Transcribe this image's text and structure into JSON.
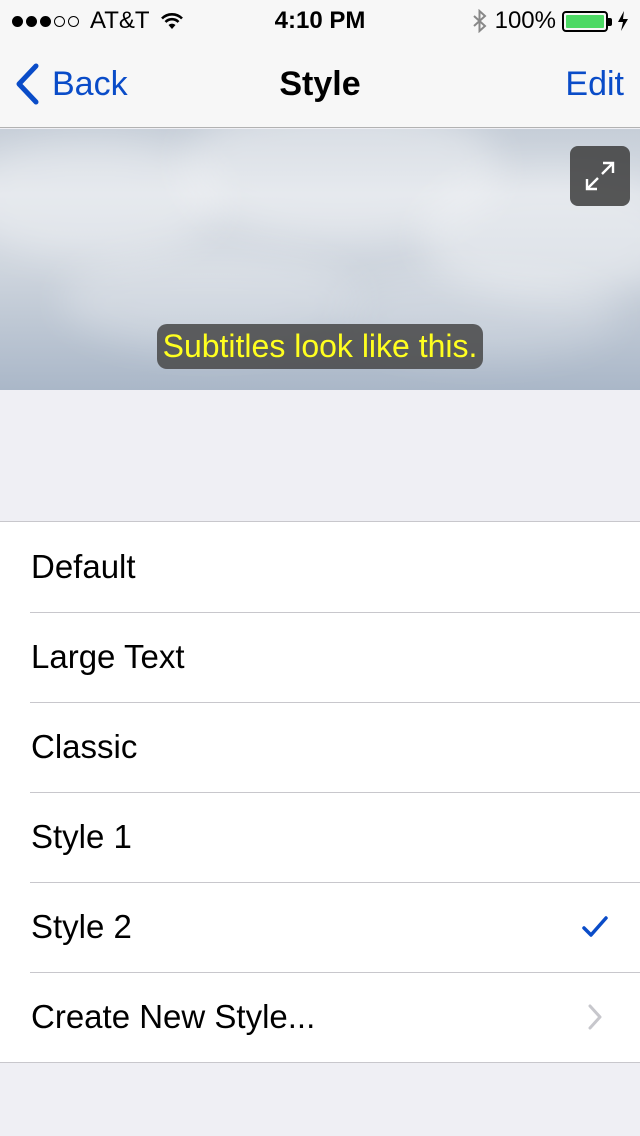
{
  "status_bar": {
    "carrier": "AT&T",
    "time": "4:10 PM",
    "battery": "100%",
    "signal_filled": 3,
    "signal_total": 5
  },
  "nav": {
    "back_label": "Back",
    "title": "Style",
    "edit_label": "Edit"
  },
  "preview": {
    "subtitle_text": "Subtitles look like this."
  },
  "styles": {
    "items": [
      {
        "label": "Default"
      },
      {
        "label": "Large Text"
      },
      {
        "label": "Classic"
      },
      {
        "label": "Style 1"
      },
      {
        "label": "Style 2",
        "accessory": "checkmark"
      },
      {
        "label": "Create New Style...",
        "accessory": "chevron"
      }
    ]
  },
  "colors": {
    "tint": "#0a4cc8",
    "subtitle_text": "#ffff20",
    "battery": "#4cd964"
  }
}
